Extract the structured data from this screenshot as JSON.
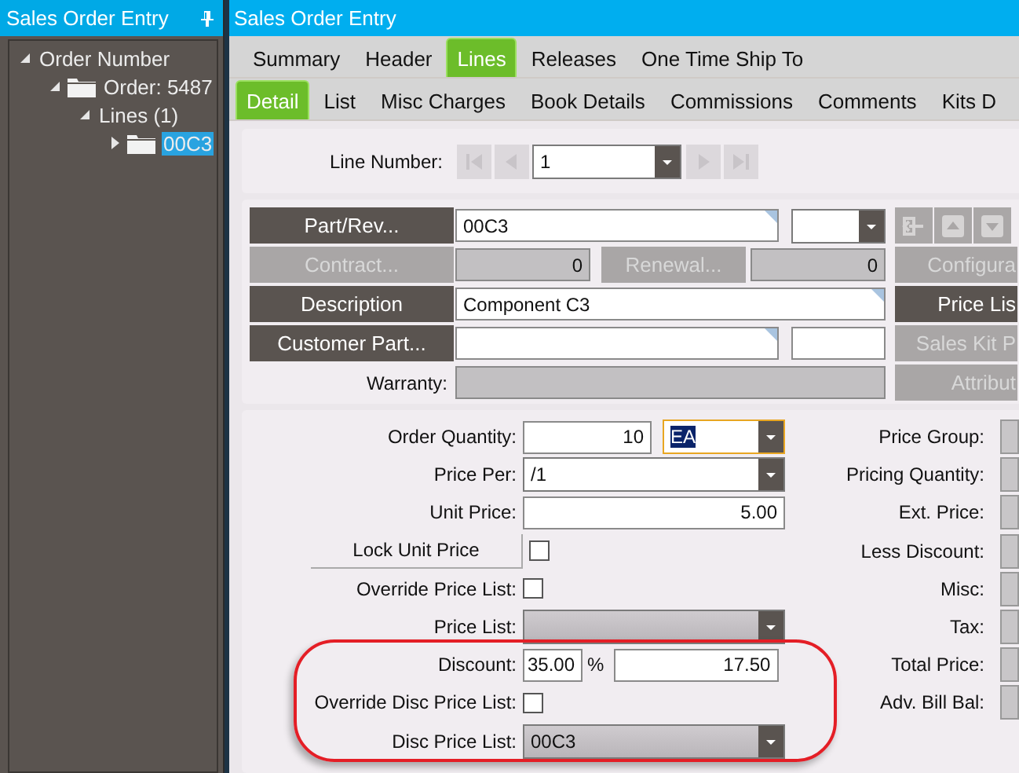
{
  "sidebar": {
    "title": "Sales Order Entry",
    "tree": [
      {
        "label": "Order Number",
        "folder": false,
        "expanded": true,
        "selected": false,
        "children": [
          {
            "label": "Order: 5487",
            "folder": true,
            "expanded": true,
            "selected": false,
            "children": [
              {
                "label": "Lines (1)",
                "folder": false,
                "expanded": true,
                "selected": false,
                "children": [
                  {
                    "label": "00C3",
                    "folder": true,
                    "expanded": false,
                    "selected": true
                  }
                ]
              }
            ]
          }
        ]
      }
    ]
  },
  "window": {
    "title": "Sales Order Entry"
  },
  "tabs": [
    {
      "label": "Summary",
      "selected": false
    },
    {
      "label": "Header",
      "selected": false
    },
    {
      "label": "Lines",
      "selected": true
    },
    {
      "label": "Releases",
      "selected": false
    },
    {
      "label": "One Time Ship To",
      "selected": false
    }
  ],
  "subtabs": [
    {
      "label": "Detail",
      "selected": true
    },
    {
      "label": "List",
      "selected": false
    },
    {
      "label": "Misc Charges",
      "selected": false
    },
    {
      "label": "Book Details",
      "selected": false
    },
    {
      "label": "Commissions",
      "selected": false
    },
    {
      "label": "Comments",
      "selected": false
    },
    {
      "label": "Kits D",
      "selected": false
    }
  ],
  "line_number": {
    "label": "Line Number:",
    "value": "1"
  },
  "part": {
    "part_button": {
      "label": "Part/Rev...",
      "disabled": false
    },
    "part_value": "00C3",
    "contract_button": {
      "label": "Contract...",
      "disabled": true
    },
    "contract_value": "0",
    "renewal_button": {
      "label": "Renewal...",
      "disabled": true
    },
    "renewal_value": "0",
    "description_button": {
      "label": "Description",
      "disabled": false
    },
    "description_value": "Component C3",
    "customer_part_button": {
      "label": "Customer Part...",
      "disabled": false
    },
    "warranty_label": "Warranty:",
    "side_buttons": [
      {
        "label": "Configura",
        "disabled": true
      },
      {
        "label": "Price Lis",
        "disabled": false
      },
      {
        "label": "Sales Kit P",
        "disabled": true
      },
      {
        "label": "Attribut",
        "disabled": true
      }
    ]
  },
  "pricing_left": [
    {
      "kind": "quantity",
      "label": "Order Quantity:",
      "value": "10",
      "unit": "EA"
    },
    {
      "kind": "dropdown",
      "label": "Price Per:",
      "value": "/1",
      "disabled": false
    },
    {
      "kind": "field",
      "label": "Unit Price:",
      "value": "5.00"
    },
    {
      "kind": "lock",
      "label": "Lock Unit Price",
      "checked": false
    },
    {
      "kind": "check",
      "label": "Override Price List:",
      "checked": false
    },
    {
      "kind": "dropdown",
      "label": "Price List:",
      "disabled": true
    },
    {
      "kind": "discount",
      "label": "Discount:",
      "percent": "35.00",
      "symbol": "%",
      "amount": "17.50"
    },
    {
      "kind": "check",
      "label": "Override Disc Price List:",
      "checked": false
    },
    {
      "kind": "dropdown",
      "label": "Disc Price List:",
      "value": "00C3",
      "disabled": true
    }
  ],
  "pricing_right": [
    "Price Group:",
    "Pricing Quantity:",
    "Ext. Price:",
    "Less Discount:",
    "Misc:",
    "Tax:",
    "Total Price:",
    "Adv. Bill Bal:"
  ]
}
